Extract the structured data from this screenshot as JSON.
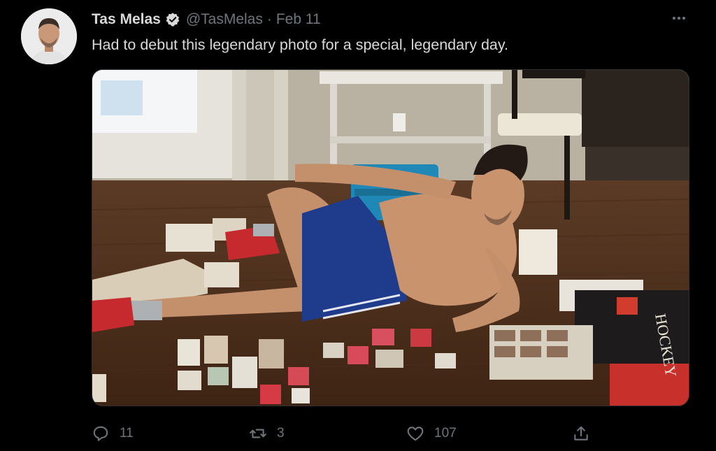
{
  "tweet": {
    "author_name": "Tas Melas",
    "author_handle": "@TasMelas",
    "separator": "·",
    "date": "Feb 11",
    "text": "Had to debut this legendary photo for a special, legendary day."
  },
  "photo": {
    "album_title": "HOCKEY"
  },
  "actions": {
    "reply_count": "11",
    "retweet_count": "3",
    "like_count": "107"
  },
  "icons": {
    "verified": "verified-badge-icon",
    "more": "more-dots-icon",
    "reply": "reply-icon",
    "retweet": "retweet-icon",
    "like": "like-icon",
    "share": "share-icon"
  },
  "colors": {
    "background": "#000000",
    "text": "#d9d9d9",
    "secondary": "#6e767d"
  }
}
